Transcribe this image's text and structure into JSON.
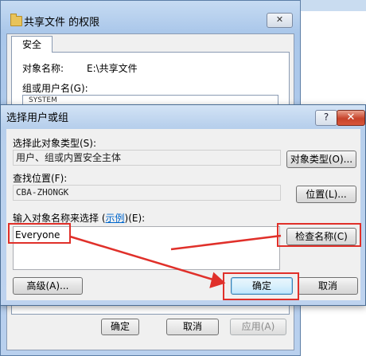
{
  "background_window": {
    "title": "共享文件 的权限",
    "tab": "安全",
    "object_name_label": "对象名称:",
    "object_name_value": "E:\\共享文件",
    "group_label": "组或用户名(G):",
    "list_item_partial": "SYSTEM",
    "buttons": {
      "ok": "确定",
      "cancel": "取消",
      "apply": "应用(A)"
    }
  },
  "dialog": {
    "title": "选择用户或组",
    "help_label": "?",
    "close_label": "✕",
    "object_type_label": "选择此对象类型(S):",
    "object_type_value": "用户、组或内置安全主体",
    "object_type_button": "对象类型(O)...",
    "location_label": "查找位置(F):",
    "location_value": "CBA-ZHONGK",
    "location_button": "位置(L)...",
    "enter_names_label_prefix": "输入对象名称来选择 (",
    "enter_names_link": "示例",
    "enter_names_label_suffix": ")(E):",
    "names_input_value": "Everyone",
    "check_names_button": "检查名称(C)",
    "advanced_button": "高级(A)...",
    "ok_button": "确定",
    "cancel_button": "取消"
  },
  "annotation_color": "#e0302a"
}
